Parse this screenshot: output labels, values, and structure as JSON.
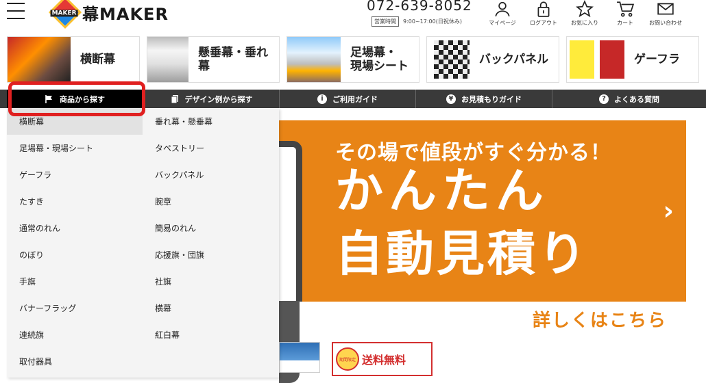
{
  "header": {
    "logo_text": "幕MAKER",
    "logo_badge": "MAKER",
    "phone": "072-639-8052",
    "hours_tag": "営業時間",
    "hours": "9:00~17:00(日祝休み)",
    "utility": [
      {
        "label": "マイページ",
        "icon": "person-icon"
      },
      {
        "label": "ログアウト",
        "icon": "lock-icon"
      },
      {
        "label": "お気に入り",
        "icon": "star-icon"
      },
      {
        "label": "カート",
        "icon": "cart-icon"
      },
      {
        "label": "お問い合わせ",
        "icon": "mail-icon"
      }
    ]
  },
  "categories": [
    {
      "label": "横断幕"
    },
    {
      "label": "懸垂幕・垂れ幕"
    },
    {
      "label": "足場幕・\n現場シート"
    },
    {
      "label": "バックパネル"
    },
    {
      "label": "ゲーフラ"
    }
  ],
  "nav": [
    {
      "label": "商品から探す",
      "icon": "flag-icon"
    },
    {
      "label": "デザイン例から探す",
      "icon": "copy-icon"
    },
    {
      "label": "ご利用ガイド",
      "icon": "info-icon"
    },
    {
      "label": "お見積もりガイド",
      "icon": "yen-icon"
    },
    {
      "label": "よくある質問",
      "icon": "question-icon"
    }
  ],
  "dropdown": {
    "items": [
      "横断幕",
      "垂れ幕・懸垂幕",
      "足場幕・現場シート",
      "タペストリー",
      "ゲーフラ",
      "バックパネル",
      "たすき",
      "腕章",
      "通常のれん",
      "簡易のれん",
      "のぼり",
      "応援旗・団旗",
      "手旗",
      "社旗",
      "バナーフラッグ",
      "横幕",
      "連続旗",
      "紅白幕",
      "取付器具",
      ""
    ]
  },
  "hero": {
    "sub": "その場で値段がすぐ分かる！",
    "big1": "かんたん",
    "big2": "自動見積り",
    "arrow": "›",
    "link": "詳しくはこちら"
  },
  "promo": {
    "ship_text": "送料無料",
    "burst_text": "期間限定"
  },
  "colors": {
    "accent_orange": "#e88416",
    "nav_bg": "#3a3a3a",
    "highlight_red": "#e02020"
  }
}
